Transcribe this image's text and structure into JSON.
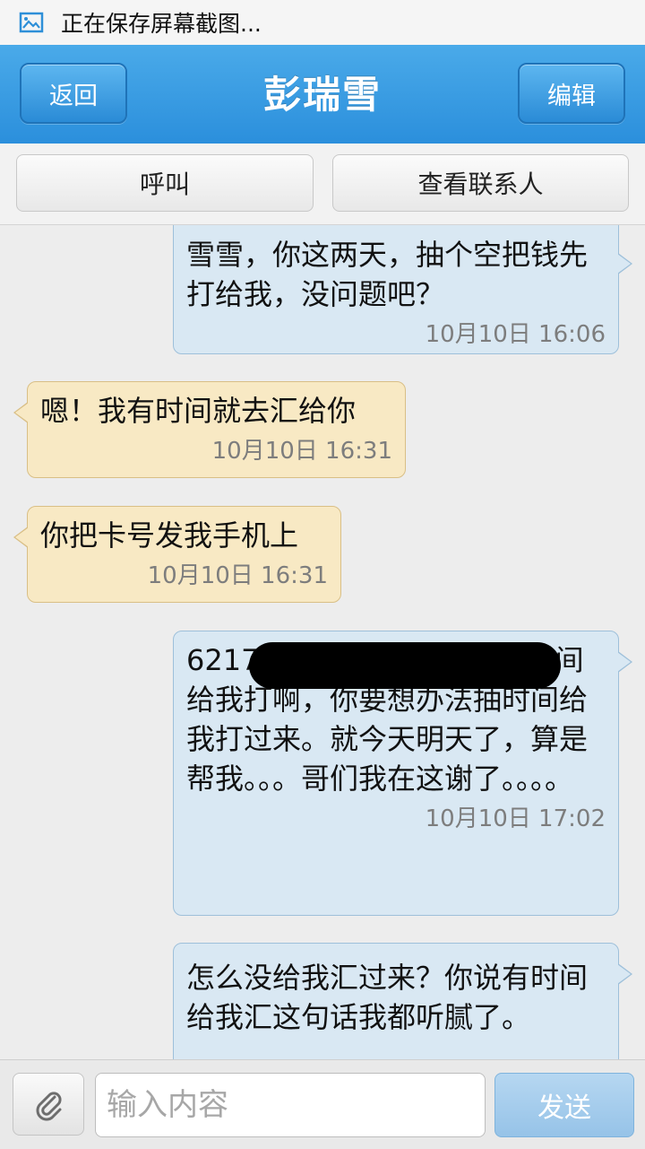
{
  "status_bar": {
    "icon": "screenshot-icon",
    "text": "正在保存屏幕截图..."
  },
  "header": {
    "back_label": "返回",
    "title": "彭瑞雪",
    "edit_label": "编辑"
  },
  "actions": {
    "call_label": "呼叫",
    "view_contact_label": "查看联系人"
  },
  "messages": [
    {
      "direction": "outgoing",
      "text": "雪雪，你这两天，抽个空把钱先打给我，没问题吧？",
      "time": "10月10日 16:06"
    },
    {
      "direction": "incoming",
      "text": "嗯！我有时间就去汇给你",
      "time": "10月10日 16:31"
    },
    {
      "direction": "incoming",
      "text": "你把卡号发我手机上",
      "time": "10月10日 16:31"
    },
    {
      "direction": "outgoing",
      "text": "6217              建设银行，你别说有时间给我打啊，你要想办法抽时间给我打过来。就今天明天了，算是帮我。。。哥们我在这谢了。。。。",
      "time": "10月10日 17:02",
      "redacted": true
    },
    {
      "direction": "outgoing",
      "text": "怎么没给我汇过来？你说有时间给我汇这句话我都听腻了。",
      "time": ""
    }
  ],
  "compose": {
    "attach_icon": "paperclip-icon",
    "input_placeholder": "输入内容",
    "input_value": "",
    "send_label": "发送"
  },
  "colors": {
    "header_blue": "#2b8fdc",
    "outgoing_bubble": "#d9e8f3",
    "incoming_bubble": "#f8e9c4"
  }
}
